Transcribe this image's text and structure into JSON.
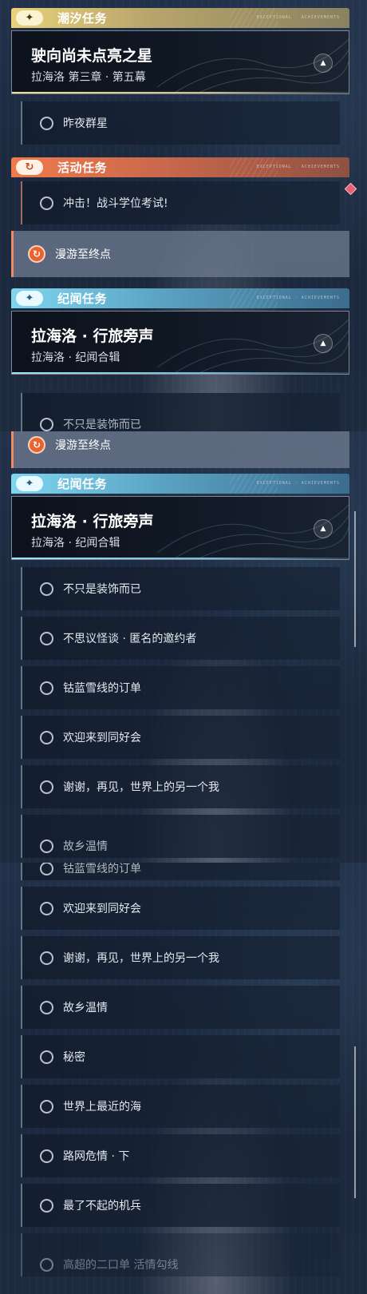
{
  "panel1": {
    "tide_section": {
      "label": "潮汐任务",
      "icon": "star-icon",
      "deco": "EXCEPTIONAL · ACHIEVEMENTS"
    },
    "tide_card": {
      "title": "驶向尚未点亮之星",
      "subtitle": "拉海洛 第三章 · 第五幕",
      "toggle": "▲"
    },
    "tide_items": [
      "昨夜群星"
    ],
    "event_section": {
      "label": "活动任务",
      "icon": "return-arrow-icon",
      "deco": "EXCEPTIONAL · ACHIEVEMENTS"
    },
    "event_items": [
      "冲击！战斗学位考试!"
    ],
    "event_selected": "漫游至终点",
    "lore_section": {
      "label": "纪闻任务",
      "icon": "star-icon",
      "deco": "EXCEPTIONAL · ACHIEVEMENTS"
    },
    "lore_card": {
      "title": "拉海洛 · 行旅旁声",
      "subtitle": "拉海洛 · 纪闻合辑",
      "toggle": "▲"
    },
    "lore_partial": "不只是装饰而已"
  },
  "panel2": {
    "partial_selected": "漫游至终点",
    "lore_section": {
      "label": "纪闻任务",
      "icon": "star-icon",
      "deco": "EXCEPTIONAL · ACHIEVEMENTS"
    },
    "lore_card": {
      "title": "拉海洛 · 行旅旁声",
      "subtitle": "拉海洛 · 纪闻合辑",
      "toggle": "▲"
    },
    "lore_items": [
      "不只是装饰而已",
      "不思议怪谈 · 匿名的邀约者",
      "钴蓝雪线的订单",
      "欢迎来到同好会",
      "谢谢，再见，世界上的另一个我"
    ],
    "lore_partial": "故乡温情"
  },
  "panel3": {
    "partial_top": "钴蓝雪线的订单",
    "lore_items": [
      "欢迎来到同好会",
      "谢谢，再见，世界上的另一个我",
      "故乡温情",
      "秘密",
      "世界上最近的海",
      "路网危情 · 下",
      "最了不起的机兵"
    ],
    "partial_bottom": "高超的二口单 活情勾线"
  },
  "colors": {
    "tide": "#e9d27a",
    "event": "#f07a4c",
    "lore": "#7fd6ef",
    "selected_accent": "#e9632f",
    "alert": "#e86075"
  }
}
